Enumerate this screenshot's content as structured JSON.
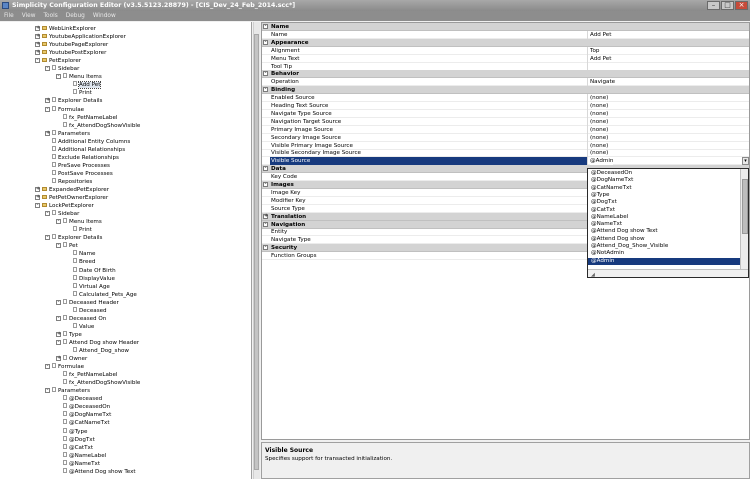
{
  "title": "Simplicity Configuration Editor (v3.5.5123.28879) - [CIS_Dev_24_Feb_2014.scc*]",
  "menu": [
    "File",
    "View",
    "Tools",
    "Debug",
    "Window"
  ],
  "tree": [
    {
      "label": "WebLinkExplorer",
      "d": 2,
      "g": "+",
      "i": "folder"
    },
    {
      "label": "YoutubeApplicationExplorer",
      "d": 2,
      "g": "+",
      "i": "folder"
    },
    {
      "label": "YoutubePageExplorer",
      "d": 2,
      "g": "+",
      "i": "folder"
    },
    {
      "label": "YoutubePostExplorer",
      "d": 2,
      "g": "+",
      "i": "folder"
    },
    {
      "label": "PetExplorer",
      "d": 2,
      "g": "-",
      "i": "folder"
    },
    {
      "label": "Sidebar",
      "d": 3,
      "g": "-",
      "i": "leaf"
    },
    {
      "label": "Menu Items",
      "d": 4,
      "g": "-",
      "i": "leaf"
    },
    {
      "label": "Add Pet",
      "d": 5,
      "g": "",
      "i": "leaf",
      "sel": true
    },
    {
      "label": "Print",
      "d": 5,
      "g": "",
      "i": "leaf"
    },
    {
      "label": "Explorer Details",
      "d": 3,
      "g": "+",
      "i": "leaf"
    },
    {
      "label": "Formulae",
      "d": 3,
      "g": "-",
      "i": "leaf"
    },
    {
      "label": "fx_PetNameLabel",
      "d": 4,
      "g": "",
      "i": "leaf"
    },
    {
      "label": "fx_AttendDogShowVisible",
      "d": 4,
      "g": "",
      "i": "leaf"
    },
    {
      "label": "Parameters",
      "d": 3,
      "g": "+",
      "i": "leaf"
    },
    {
      "label": "Additional Entity Columns",
      "d": 3,
      "g": "",
      "i": "leaf"
    },
    {
      "label": "Additional Relationships",
      "d": 3,
      "g": "",
      "i": "leaf"
    },
    {
      "label": "Exclude Relationships",
      "d": 3,
      "g": "",
      "i": "leaf"
    },
    {
      "label": "PreSave Processes",
      "d": 3,
      "g": "",
      "i": "leaf"
    },
    {
      "label": "PostSave Processes",
      "d": 3,
      "g": "",
      "i": "leaf"
    },
    {
      "label": "Repositories",
      "d": 3,
      "g": "",
      "i": "leaf"
    },
    {
      "label": "ExpandedPetExplorer",
      "d": 2,
      "g": "+",
      "i": "folder"
    },
    {
      "label": "PetPetOwnerExplorer",
      "d": 2,
      "g": "+",
      "i": "folder"
    },
    {
      "label": "LockPetExplorer",
      "d": 2,
      "g": "-",
      "i": "folder"
    },
    {
      "label": "Sidebar",
      "d": 3,
      "g": "-",
      "i": "leaf"
    },
    {
      "label": "Menu Items",
      "d": 4,
      "g": "-",
      "i": "leaf"
    },
    {
      "label": "Print",
      "d": 5,
      "g": "",
      "i": "leaf"
    },
    {
      "label": "Explorer Details",
      "d": 3,
      "g": "-",
      "i": "leaf"
    },
    {
      "label": "Pet",
      "d": 4,
      "g": "-",
      "i": "leaf"
    },
    {
      "label": "Name",
      "d": 5,
      "g": "",
      "i": "leaf"
    },
    {
      "label": "Breed",
      "d": 5,
      "g": "",
      "i": "leaf"
    },
    {
      "label": "Date Of Birth",
      "d": 5,
      "g": "",
      "i": "leaf"
    },
    {
      "label": "DisplayValue",
      "d": 5,
      "g": "",
      "i": "leaf"
    },
    {
      "label": "Virtual Age",
      "d": 5,
      "g": "",
      "i": "leaf"
    },
    {
      "label": "Calculated_Pets_Age",
      "d": 5,
      "g": "",
      "i": "leaf"
    },
    {
      "label": "Deceased Header",
      "d": 4,
      "g": "-",
      "i": "leaf"
    },
    {
      "label": "Deceased",
      "d": 5,
      "g": "",
      "i": "leaf"
    },
    {
      "label": "Deceased On",
      "d": 4,
      "g": "-",
      "i": "leaf"
    },
    {
      "label": "Value",
      "d": 5,
      "g": "",
      "i": "leaf"
    },
    {
      "label": "Type",
      "d": 4,
      "g": "+",
      "i": "leaf"
    },
    {
      "label": "Attend Dog show Header",
      "d": 4,
      "g": "-",
      "i": "leaf"
    },
    {
      "label": "Attend_Dog_show",
      "d": 5,
      "g": "",
      "i": "leaf"
    },
    {
      "label": "Owner",
      "d": 4,
      "g": "+",
      "i": "leaf"
    },
    {
      "label": "Formulae",
      "d": 3,
      "g": "-",
      "i": "leaf"
    },
    {
      "label": "fx_PetNameLabel",
      "d": 4,
      "g": "",
      "i": "leaf"
    },
    {
      "label": "fx_AttendDogShowVisible",
      "d": 4,
      "g": "",
      "i": "leaf"
    },
    {
      "label": "Parameters",
      "d": 3,
      "g": "-",
      "i": "leaf"
    },
    {
      "label": "@Deceased",
      "d": 4,
      "g": "",
      "i": "leaf"
    },
    {
      "label": "@DeceasedOn",
      "d": 4,
      "g": "",
      "i": "leaf"
    },
    {
      "label": "@DogNameTxt",
      "d": 4,
      "g": "",
      "i": "leaf"
    },
    {
      "label": "@CatNameTxt",
      "d": 4,
      "g": "",
      "i": "leaf"
    },
    {
      "label": "@Type",
      "d": 4,
      "g": "",
      "i": "leaf"
    },
    {
      "label": "@DogTxt",
      "d": 4,
      "g": "",
      "i": "leaf"
    },
    {
      "label": "@CatTxt",
      "d": 4,
      "g": "",
      "i": "leaf"
    },
    {
      "label": "@NameLabel",
      "d": 4,
      "g": "",
      "i": "leaf"
    },
    {
      "label": "@NameTxt",
      "d": 4,
      "g": "",
      "i": "leaf"
    },
    {
      "label": "@Attend Dog show Text",
      "d": 4,
      "g": "",
      "i": "leaf"
    }
  ],
  "props": [
    {
      "cat": true,
      "name": "Name",
      "ex": "-"
    },
    {
      "name": "Name",
      "value": "Add Pet"
    },
    {
      "cat": true,
      "name": "Appearance",
      "ex": "-"
    },
    {
      "name": "Alignment",
      "value": "Top"
    },
    {
      "name": "Menu Text",
      "value": "Add Pet"
    },
    {
      "name": "Tool Tip",
      "value": ""
    },
    {
      "cat": true,
      "name": "Behavior",
      "ex": "-"
    },
    {
      "name": "Operation",
      "value": "Navigate"
    },
    {
      "cat": true,
      "name": "Binding",
      "ex": "-"
    },
    {
      "name": "Enabled Source",
      "value": "(none)"
    },
    {
      "name": "Heading Text Source",
      "value": "(none)"
    },
    {
      "name": "Navigate Type Source",
      "value": "(none)"
    },
    {
      "name": "Navigation Target Source",
      "value": "(none)"
    },
    {
      "name": "Primary Image Source",
      "value": "(none)"
    },
    {
      "name": "Secondary Image Source",
      "value": "(none)"
    },
    {
      "name": "Visible Primary Image Source",
      "value": "(none)"
    },
    {
      "name": "Visible Secondary Image Source",
      "value": "(none)"
    },
    {
      "name": "Visible Source",
      "value": "@Admin",
      "sel": true
    },
    {
      "cat": true,
      "name": "Data",
      "ex": "-"
    },
    {
      "name": "Key Code",
      "value": ""
    },
    {
      "cat": true,
      "name": "Images",
      "ex": "-"
    },
    {
      "name": "Image Key",
      "value": ""
    },
    {
      "name": "Modifier Key",
      "value": ""
    },
    {
      "name": "Source Type",
      "value": ""
    },
    {
      "cat": true,
      "name": "Translation",
      "ex": "+"
    },
    {
      "cat": true,
      "name": "Navigation",
      "ex": "-"
    },
    {
      "name": "Entity",
      "value": ""
    },
    {
      "name": "Navigate Type",
      "value": ""
    },
    {
      "cat": true,
      "name": "Security",
      "ex": "-"
    },
    {
      "name": "Function Groups",
      "value": ""
    }
  ],
  "dropdown": {
    "options": [
      "@DeceasedOn",
      "@DogNameTxt",
      "@CatNameTxt",
      "@Type",
      "@DogTxt",
      "@CatTxt",
      "@NameLabel",
      "@NameTxt",
      "@Attend Dog show Text",
      "@Attend Dog show",
      "@Attend_Dog_Show_Visible",
      "@NotAdmin",
      "@Admin"
    ],
    "selected": "@Admin"
  },
  "help": {
    "title": "Visible Source",
    "desc": "Specifies support for transacted initialization."
  }
}
